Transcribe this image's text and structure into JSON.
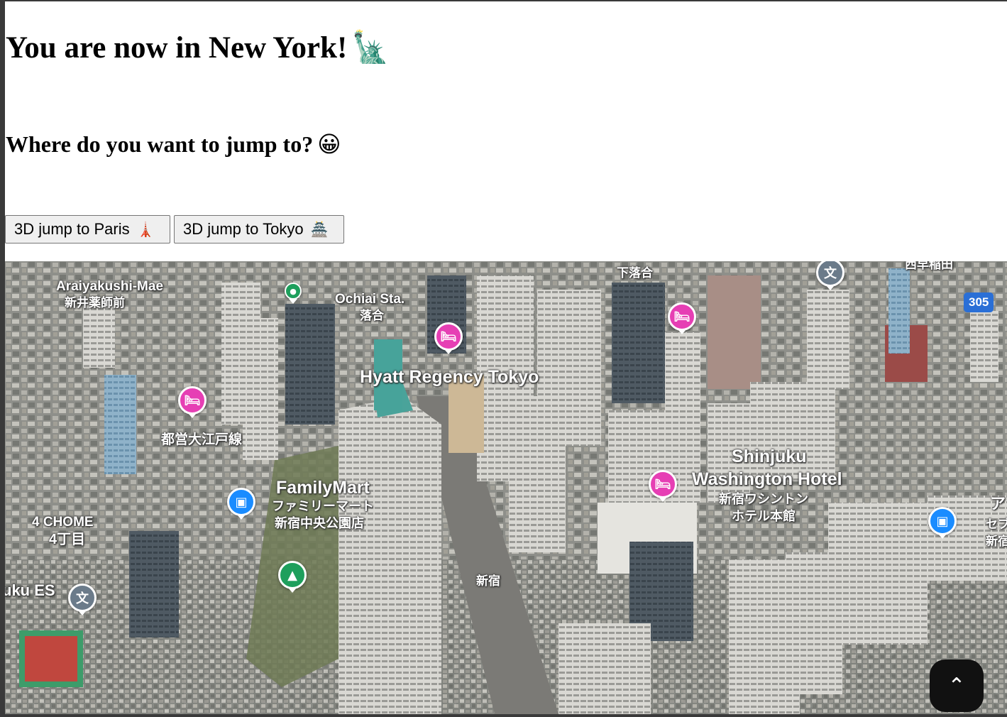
{
  "header": {
    "title": "You are now in New York!",
    "title_emoji": "🗽",
    "subtitle": "Where do you want to jump to?",
    "subtitle_emoji": "😀"
  },
  "buttons": {
    "paris_label": "3D jump to Paris",
    "paris_emoji": "🗼",
    "tokyo_label": "3D jump to Tokyo",
    "tokyo_emoji": "🏯"
  },
  "map": {
    "labels": {
      "araiyakushi": "Araiyakushi-Mae",
      "araiyakushi_jp": "新井薬師前",
      "ochiai": "Ochiai Sta.",
      "ochiai_jp": "落合",
      "shimo_ochiai_jp": "下落合",
      "top_right_jp": "西早稲田",
      "hyatt": "Hyatt Regency Tokyo",
      "oedo_line": "都営大江戸線",
      "familymart": "FamilyMart",
      "familymart_jp1": "ファミリーマート",
      "familymart_jp2": "新宿中央公園店",
      "shinjuku_wash1": "Shinjuku",
      "shinjuku_wash2": "Washington Hotel",
      "shinjuku_wash_jp1": "新宿ワシントン",
      "shinjuku_wash_jp2": "ホテル本館",
      "chome": "4 CHOME",
      "chome_jp": "4丁目",
      "uku_es": "uku ES",
      "shinjuku_jp": "新宿",
      "right_edge1": "ア",
      "right_edge2": "セブ",
      "right_edge3": "新宿"
    },
    "route_number": "305",
    "icons": {
      "hotel": "hotel-icon",
      "shop": "shop-icon",
      "park": "park-icon",
      "school": "school-icon"
    }
  },
  "scroll_top_icon": "chevron-up-icon"
}
